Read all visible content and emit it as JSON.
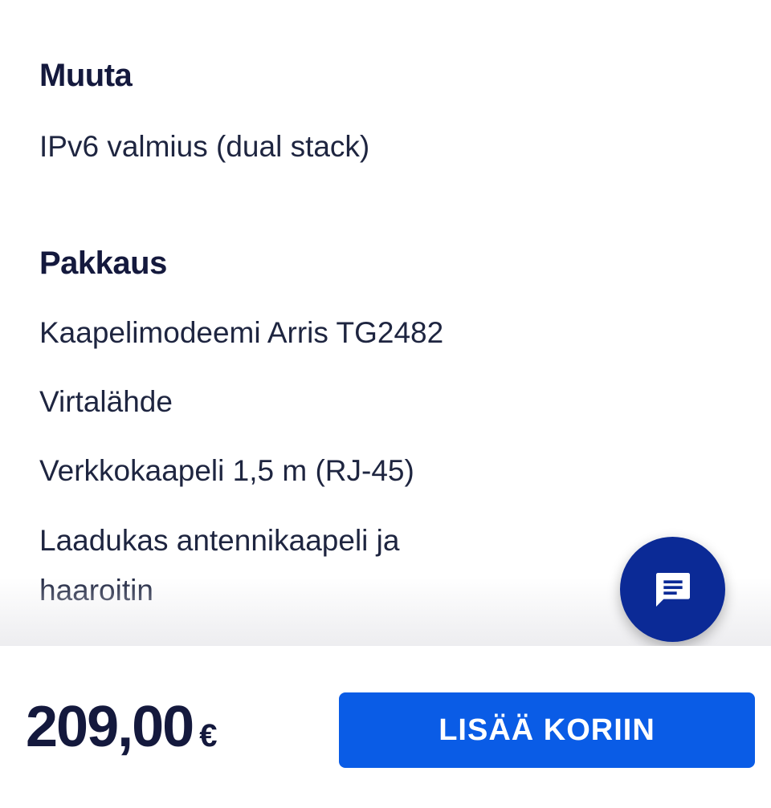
{
  "sections": {
    "muuta": {
      "heading": "Muuta",
      "items": [
        "IPv6 valmius (dual stack)"
      ]
    },
    "pakkaus": {
      "heading": "Pakkaus",
      "items": [
        "Kaapelimodeemi Arris TG2482",
        "Virtalähde",
        "Verkkokaapeli 1,5 m (RJ-45)",
        "Laadukas antennikaapeli ja",
        "haaroitin"
      ]
    }
  },
  "bottom_bar": {
    "price": "209,00",
    "currency": "€",
    "add_to_cart_label": "LISÄÄ KORIIN"
  },
  "chat": {
    "icon": "chat-icon",
    "color": "#0b2a96"
  },
  "colors": {
    "primary_button": "#0a5ce6",
    "text_dark": "#14193d"
  }
}
